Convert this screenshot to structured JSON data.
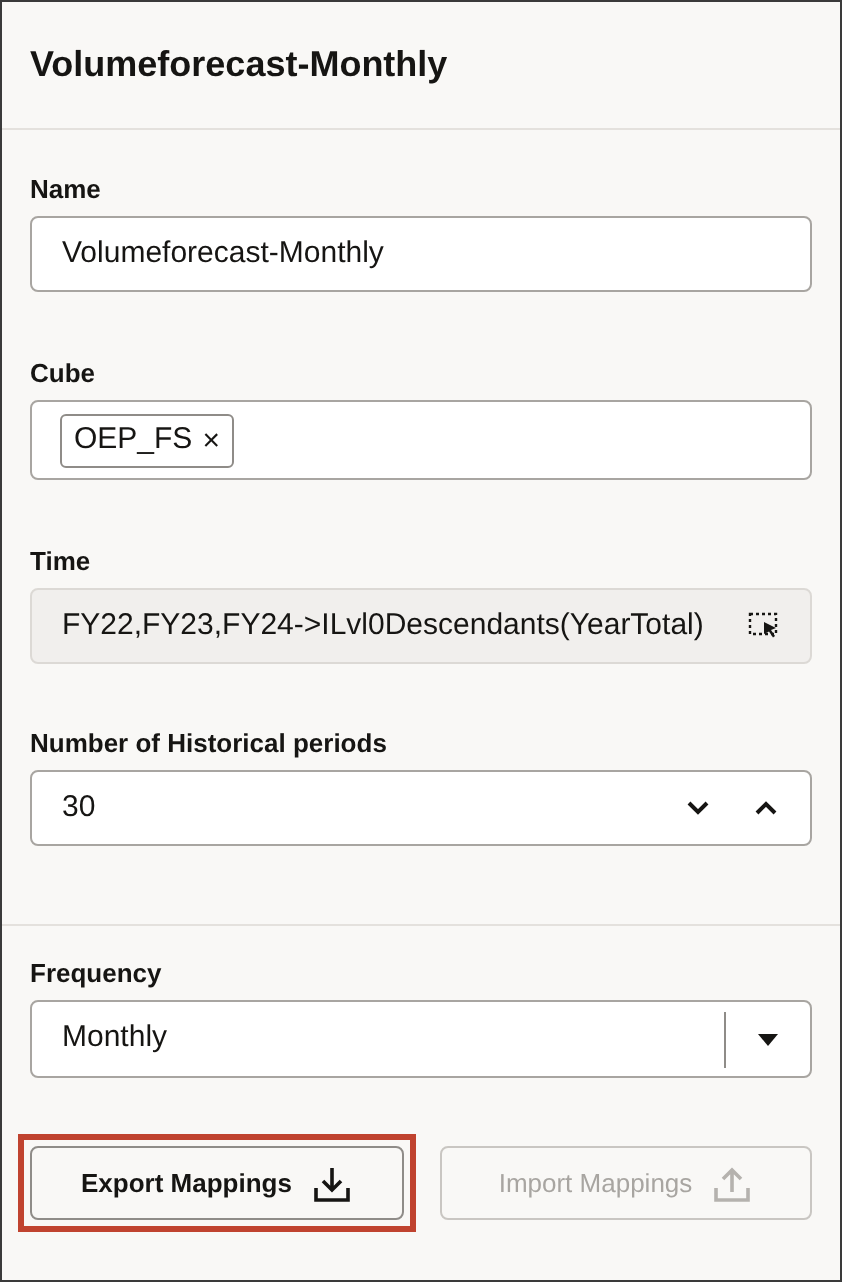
{
  "title": "Volumeforecast-Monthly",
  "name_field": {
    "label": "Name",
    "value": "Volumeforecast-Monthly"
  },
  "cube_field": {
    "label": "Cube",
    "chips": [
      "OEP_FS"
    ],
    "chip_remove": "×"
  },
  "time_field": {
    "label": "Time",
    "value": "FY22,FY23,FY24->ILvl0Descendants(YearTotal)",
    "readonly": true
  },
  "periods_field": {
    "label": "Number of Historical periods",
    "value": "30"
  },
  "frequency_field": {
    "label": "Frequency",
    "value": "Monthly"
  },
  "buttons": [
    {
      "label": "Export Mappings",
      "kind": "export",
      "disabled": false,
      "highlighted": true
    },
    {
      "label": "Import Mappings",
      "kind": "import",
      "disabled": true,
      "highlighted": false
    }
  ]
}
